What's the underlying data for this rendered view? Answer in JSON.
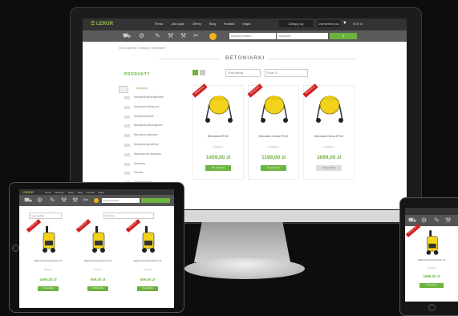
{
  "desktop": {
    "logo": "☰ LEROR",
    "nav": [
      "Firma",
      "Jak kupić",
      "Oferty",
      "Blog",
      "Kontakt",
      "Mapa"
    ],
    "account": "Zaloguj się",
    "register": "Zarejestruj się",
    "cart_value": "0,00 zł",
    "search_placeholder": "Szukaj produktu...",
    "category_select": "Wszystkie",
    "search_button": "⌕",
    "breadcrumb": "Strona główna / Maszyny / Betoniarki",
    "page_title": "BETONIARKI",
    "sidebar_title": "PRODUKTY",
    "sidebar_header": "Maszyny",
    "sidebar_items": [
      "Narzędzia akumulatorowe",
      "Narzędzia elektryczne",
      "Narzędzia ręczne",
      "Narzędzia pneumatyczne",
      "Narzędzia spalinowe",
      "Narzędzia ogrodnicze",
      "Wyposażenie warsztatu",
      "Akcesoria",
      "Chemia",
      "Odzież robocza",
      "Nowości",
      "Promocje"
    ],
    "sort_select": "Sortuj według",
    "per_page_select": "Pokaż 12",
    "products": [
      {
        "ribbon": "PROMOCJA",
        "name": "Betoniarka BT160",
        "availability": "Dostępny",
        "price": "1459,00 zł",
        "button": "Do koszyka",
        "button_style": "green"
      },
      {
        "ribbon": "PROMOCJA",
        "name": "Betoniarka Cedrus BT140",
        "availability": "Dostępny",
        "price": "1199,00 zł",
        "button": "Do koszyka",
        "button_style": "green"
      },
      {
        "ribbon": "PROMOCJA",
        "name": "Betoniarka Cedrus BT120",
        "availability": "Dostępny",
        "price": "1699,00 zł",
        "button": "Do koszyka",
        "button_style": "grey"
      }
    ]
  },
  "tablet": {
    "logo": "LEROR",
    "nav": [
      "Firma",
      "Jak kupić",
      "Oferty",
      "Blog",
      "Kontakt",
      "Mapa"
    ],
    "search_placeholder": "Szukaj produktu...",
    "sort_select": "Sortuj według",
    "per_page_select": "Pokaż 12",
    "products": [
      {
        "ribbon": "PROMOCJA",
        "name": "Myjka ciśnieniowa Karcher K2",
        "availability": "Dostępny",
        "price": "1699,00 zł",
        "button": "Do koszyka"
      },
      {
        "ribbon": "PROMOCJA",
        "name": "Myjka ciśnieniowa Karcher K4",
        "availability": "Dostępny",
        "price": "699,00 zł",
        "button": "Do koszyka"
      },
      {
        "ribbon": "PROMOCJA",
        "name": "Myjka ciśnieniowa Karcher K3",
        "availability": "Dostępny",
        "price": "699,00 zł",
        "button": "Do koszyka"
      }
    ]
  },
  "phone": {
    "product": {
      "ribbon": "PROMOCJA",
      "name": "Myjka ciśnieniowa Karcher K2",
      "availability": "Dostępny",
      "price": "1699,00 zł",
      "button": "Do koszyka"
    }
  },
  "colors": {
    "accent": "#6db33f",
    "header_dark": "#333333",
    "category_bar": "#5a5a5a",
    "sale_ribbon": "#d02020",
    "product_yellow": "#f2d21b",
    "badge": "#f2b21b"
  }
}
